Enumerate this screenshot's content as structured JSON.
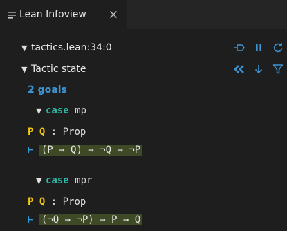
{
  "tab": {
    "title": "Lean Infoview",
    "icon": "menu-lines-icon",
    "close_icon": "close-icon"
  },
  "location": {
    "label": "tactics.lean:34:0"
  },
  "tactic_state": {
    "label": "Tactic state",
    "goals_count_label": "2 goals",
    "goals": [
      {
        "case_keyword": "case",
        "case_name": "mp",
        "hypotheses": {
          "names": "P Q",
          "sep": ":",
          "type": "Prop"
        },
        "turnstile": "⊢",
        "goal": "(P → Q) → ¬Q → ¬P"
      },
      {
        "case_keyword": "case",
        "case_name": "mpr",
        "hypotheses": {
          "names": "P Q",
          "sep": ":",
          "type": "Prop"
        },
        "turnstile": "⊢",
        "goal": "(¬Q → ¬P) → P → Q"
      }
    ]
  },
  "toolbar": {
    "icons": [
      "pin-icon",
      "pause-icon",
      "refresh-icon",
      "quote-icon",
      "arrow-down-icon",
      "filter-icon"
    ]
  },
  "colors": {
    "background": "#1e1e1e",
    "tabbar": "#252526",
    "accent_blue": "#3e94d1",
    "keyword_teal": "#2eb8a8",
    "hyp_yellow": "#f2c811",
    "goal_bg": "#3d4a25"
  }
}
